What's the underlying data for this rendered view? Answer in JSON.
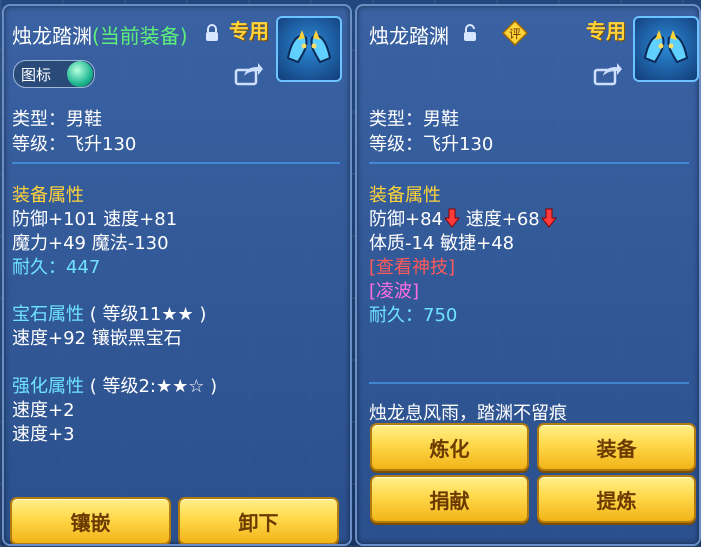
{
  "left": {
    "title": "烛龙踏渊",
    "current_tag": "(当前装备)",
    "zhuanyong": "专用",
    "toggle_label": "图标",
    "type_line": "类型：男鞋",
    "level_line": "等级：飞升130",
    "equip_header": "装备属性",
    "stat1": "防御+101 速度+81",
    "stat2": "魔力+49 魔法-130",
    "durability_label": "耐久：",
    "durability_value": "447",
    "gem_header": "宝石属性",
    "gem_level": "( 等级11★★ )",
    "gem_line": "速度+92 镶嵌黑宝石",
    "enhance_header": "强化属性",
    "enhance_level": "( 等级2:★★☆ )",
    "enhance1": "速度+2",
    "enhance2": "速度+3",
    "buttons": [
      "镶嵌",
      "卸下"
    ]
  },
  "right": {
    "title": "烛龙踏渊",
    "ping": "评",
    "zhuanyong": "专用",
    "type_line": "类型：男鞋",
    "level_line": "等级：飞升130",
    "equip_header": "装备属性",
    "stat1a": "防御+84",
    "stat1b": "速度+68",
    "stat2": "体质-14 敏捷+48",
    "skill_link": "[查看神技]",
    "special": "[凌波]",
    "durability_label": "耐久：",
    "durability_value": "750",
    "flavor": "烛龙息风雨，踏渊不留痕",
    "buttons": [
      "炼化",
      "装备",
      "捐献",
      "提炼"
    ]
  },
  "colors": {
    "title": "#ffffff",
    "current": "#5cf07a",
    "section": "#ffd33a",
    "durability": "#6fe3ff",
    "link_red": "#ff5a5a",
    "special_magenta": "#ff6ee0",
    "button": "#ffd84a"
  },
  "icons": [
    "lock-closed-icon",
    "lock-open-icon",
    "share-icon",
    "item-shoe-icon",
    "down-arrow-icon",
    "ping-badge-icon"
  ]
}
